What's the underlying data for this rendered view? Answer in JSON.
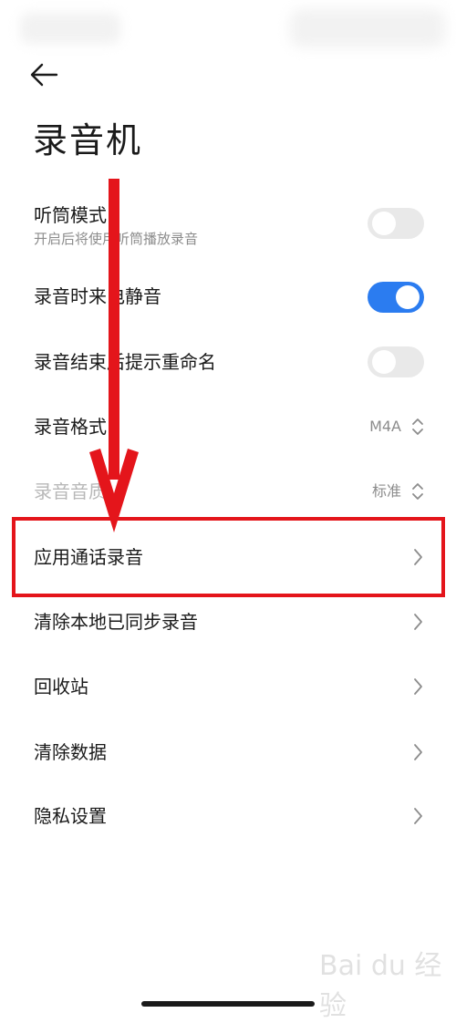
{
  "header": {
    "back_icon": "arrow-left-icon",
    "title": "录音机"
  },
  "settings": [
    {
      "label": "听筒模式",
      "sub": "开启后将使用听筒播放录音",
      "control": "toggle",
      "state": "off"
    },
    {
      "label": "录音时来电静音",
      "control": "toggle",
      "state": "on"
    },
    {
      "label": "录音结束后提示重命名",
      "control": "toggle",
      "state": "off"
    },
    {
      "label": "录音格式",
      "control": "select",
      "value": "M4A"
    },
    {
      "label": "录音音质",
      "control": "select",
      "value": "标准",
      "disabled": true
    },
    {
      "label": "应用通话录音",
      "control": "link",
      "highlighted": true
    },
    {
      "label": "清除本地已同步录音",
      "control": "link"
    },
    {
      "label": "回收站",
      "control": "link"
    },
    {
      "label": "清除数据",
      "control": "link"
    },
    {
      "label": "隐私设置",
      "control": "link"
    }
  ],
  "colors": {
    "toggle_on": "#2b7cf0",
    "toggle_off": "#e9e9e9",
    "annotation_red": "#e4151b"
  },
  "annotation": {
    "arrow": "red-down-arrow",
    "box": "red-highlight-box"
  },
  "watermark": {
    "text": "Bai du 经验"
  }
}
